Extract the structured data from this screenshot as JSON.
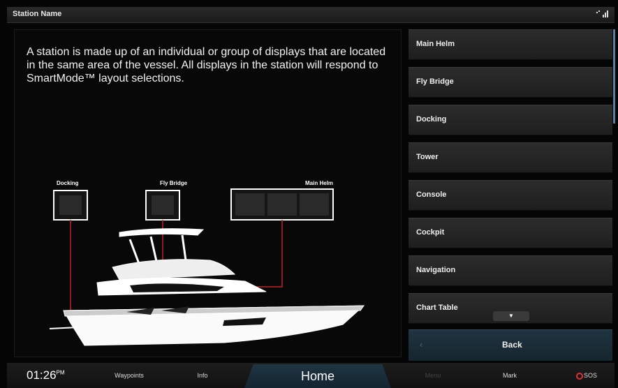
{
  "titlebar": {
    "title": "Station Name",
    "signal": "¹⁷ᵗᵗ│"
  },
  "description": "A station is made up of an individual or group of displays that are located in the same area of the vessel. All displays in the station will respond to SmartMode™ layout selections.",
  "illustration": {
    "labels": {
      "docking": "Docking",
      "fly_bridge": "Fly Bridge",
      "main_helm": "Main Helm"
    }
  },
  "menu": {
    "items": [
      {
        "label": "Main Helm"
      },
      {
        "label": "Fly Bridge"
      },
      {
        "label": "Docking"
      },
      {
        "label": "Tower"
      },
      {
        "label": "Console"
      },
      {
        "label": "Cockpit"
      },
      {
        "label": "Navigation"
      },
      {
        "label": "Chart Table"
      }
    ],
    "back_label": "Back"
  },
  "bottombar": {
    "clock": "01:26",
    "clock_suffix": "PM",
    "waypoints": "Waypoints",
    "info": "Info",
    "home": "Home",
    "menu": "Menu",
    "mark": "Mark",
    "sos": "SOS"
  },
  "colors": {
    "accent": "#1f3542",
    "sos": "#dd3333",
    "line": "#c0202a"
  }
}
